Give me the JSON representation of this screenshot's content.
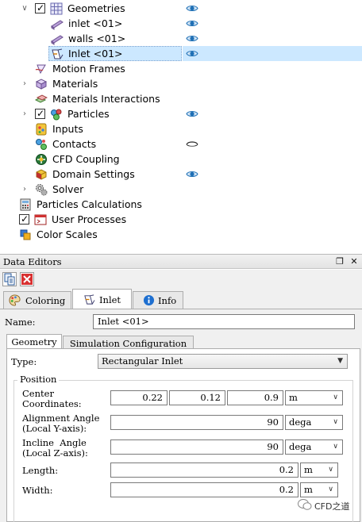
{
  "tree": {
    "items": [
      {
        "label": "Geometries",
        "icon": "geometries-icon",
        "checkbox": true,
        "checked": true,
        "expander": "expanded",
        "eye": true
      },
      {
        "label": "inlet <01>",
        "icon": "geometry-bar-icon",
        "eye": true
      },
      {
        "label": "walls <01>",
        "icon": "geometry-bar-icon",
        "eye": true
      },
      {
        "label": "Inlet <01>",
        "icon": "inlet-icon",
        "eye": true,
        "selected": true
      },
      {
        "label": "Motion Frames",
        "icon": "motion-frames-icon"
      },
      {
        "label": "Materials",
        "icon": "materials-icon",
        "expander": "collapsed"
      },
      {
        "label": "Materials Interactions",
        "icon": "materials-interactions-icon"
      },
      {
        "label": "Particles",
        "icon": "particles-icon",
        "checkbox": true,
        "checked": true,
        "expander": "collapsed",
        "eye": true
      },
      {
        "label": "Inputs",
        "icon": "inputs-icon"
      },
      {
        "label": "Contacts",
        "icon": "contacts-icon",
        "eye_closed": true
      },
      {
        "label": "CFD Coupling",
        "icon": "cfd-coupling-icon"
      },
      {
        "label": "Domain Settings",
        "icon": "domain-settings-icon",
        "eye": true
      },
      {
        "label": "Solver",
        "icon": "solver-icon",
        "expander": "collapsed"
      },
      {
        "label": "Particles Calculations",
        "icon": "calculator-icon"
      },
      {
        "label": "User Processes",
        "icon": "user-processes-icon",
        "checkbox": true,
        "checked": true
      },
      {
        "label": "Color Scales",
        "icon": "color-scales-icon"
      }
    ]
  },
  "editor": {
    "title": "Data Editors",
    "tabs": [
      {
        "label": "Coloring",
        "icon": "palette-icon"
      },
      {
        "label": "Inlet",
        "icon": "inlet-icon",
        "active": true
      },
      {
        "label": "Info",
        "icon": "info-icon"
      }
    ],
    "name_label": "Name:",
    "name_value": "Inlet <01>",
    "subtabs": [
      {
        "label": "Geometry",
        "active": true
      },
      {
        "label": "Simulation Configuration"
      }
    ],
    "type_label": "Type:",
    "type_value": "Rectangular Inlet",
    "position_group_label": "Position",
    "center_label_1": "Center",
    "center_label_2": "Coordinates:",
    "center_x": "0.22",
    "center_y": "0.12",
    "center_z": "0.9",
    "center_unit": "m",
    "alignment_label_1": "Alignment Angle",
    "alignment_label_2": "(Local Y-axis):",
    "alignment_value": "90",
    "alignment_unit": "dega",
    "incline_label_1": "Incline  Angle",
    "incline_label_2": "(Local Z-axis):",
    "incline_value": "90",
    "incline_unit": "dega",
    "length_label": "Length:",
    "length_value": "0.2",
    "length_unit": "m",
    "width_label": "Width:",
    "width_value": "0.2",
    "width_unit": "m"
  },
  "watermark": "CFD之道",
  "colors": {
    "selection": "#cce8ff",
    "eye": "#1e6fb5",
    "panel_bg": "#f0f0f0"
  }
}
